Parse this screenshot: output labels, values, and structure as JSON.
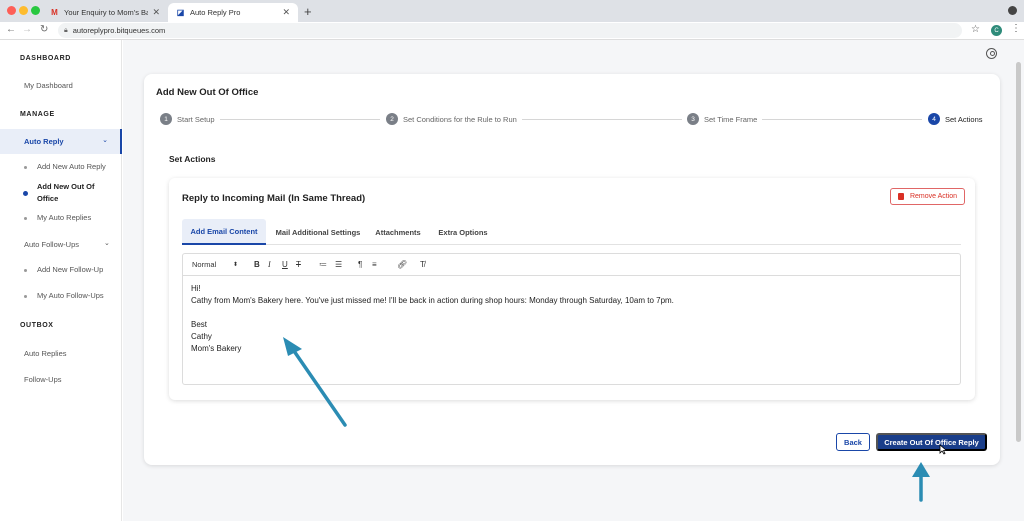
{
  "browser": {
    "tabs": [
      {
        "title": "Your Enquiry to Mom's Bakery",
        "icon": "gmail-icon",
        "active": false
      },
      {
        "title": "Auto Reply Pro",
        "icon": "auto-reply-pro-icon",
        "active": true
      }
    ],
    "new_tab_symbol": "+",
    "url": "autoreplypro.bitqueues.com",
    "profile_initial": "C"
  },
  "sidebar": {
    "dashboard_heading": "DASHBOARD",
    "my_dashboard": "My Dashboard",
    "manage_heading": "MANAGE",
    "auto_reply": "Auto Reply",
    "auto_reply_items": [
      "Add New Auto Reply",
      "Add New Out Of Office",
      "My Auto Replies"
    ],
    "auto_follow_ups": "Auto Follow-Ups",
    "follow_up_items": [
      "Add New Follow-Up",
      "My Auto Follow-Ups"
    ],
    "outbox_heading": "OUTBOX",
    "outbox_items": [
      "Auto Replies",
      "Follow-Ups"
    ]
  },
  "page": {
    "title": "Add New Out Of Office",
    "steps": [
      {
        "num": "1",
        "label": "Start Setup"
      },
      {
        "num": "2",
        "label": "Set Conditions for the Rule to Run"
      },
      {
        "num": "3",
        "label": "Set Time Frame"
      },
      {
        "num": "4",
        "label": "Set Actions"
      }
    ],
    "current_step": 4,
    "section_title": "Set Actions",
    "action": {
      "title": "Reply to Incoming Mail (In Same Thread)",
      "remove_label": "Remove Action",
      "tabs": [
        "Add Email Content",
        "Mail Additional Settings",
        "Attachments",
        "Extra Options"
      ],
      "active_tab": 0,
      "toolbar": {
        "format": "Normal"
      },
      "body_lines": [
        "Hi!",
        "Cathy from Mom's Bakery here. You've just missed me! I'll be back in action during shop hours: Monday through Saturday, 10am to 7pm.",
        "",
        "Best",
        "Cathy",
        "Mom's Bakery"
      ]
    },
    "back_label": "Back",
    "create_label": "Create Out Of Office Reply"
  },
  "colors": {
    "brand": "#1a47a8",
    "brand_dark": "#1a3e8a",
    "danger": "#d93025",
    "annotation_arrow": "#2b8cb3"
  }
}
